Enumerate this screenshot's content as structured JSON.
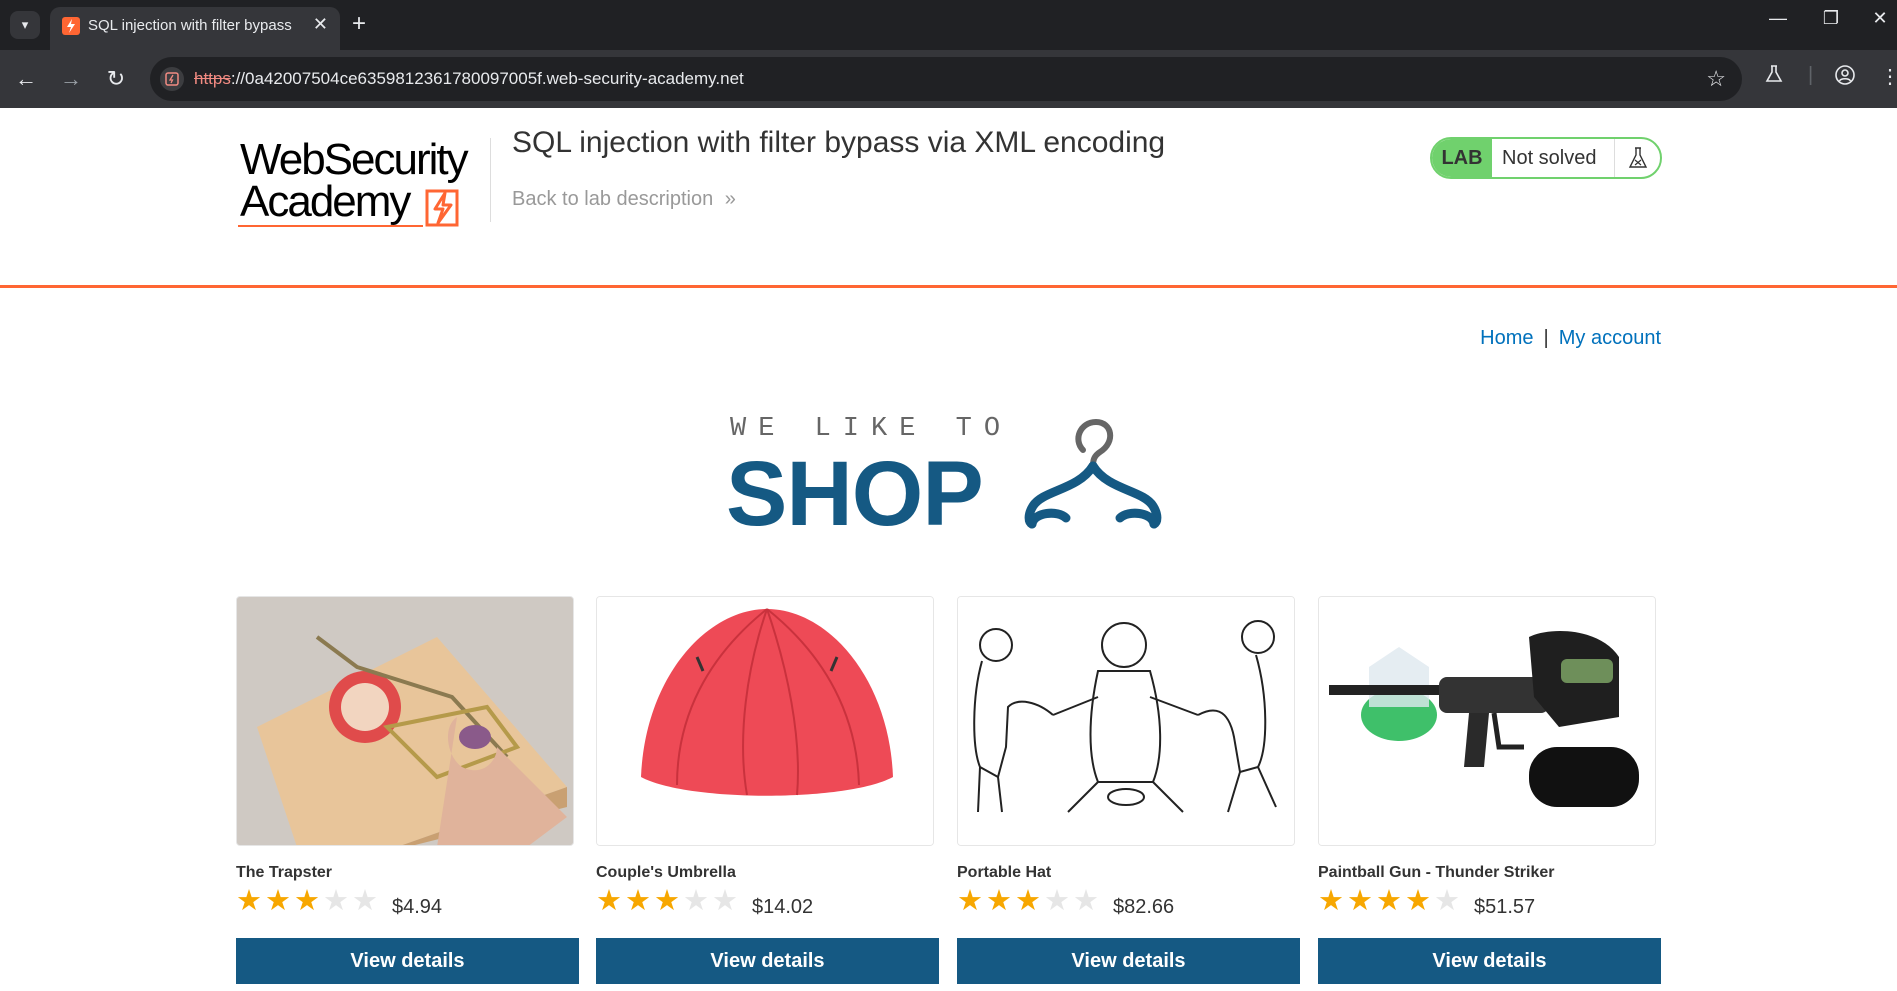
{
  "browser": {
    "tab_title": "SQL injection with filter bypass",
    "url_scheme": "https",
    "url_rest": "://0a42007504ce6359812361780097005f.web-security-academy.net"
  },
  "header": {
    "logo_line1": "WebSecurity",
    "logo_line2": "Academy",
    "lab_title": "SQL injection with filter bypass via XML encoding",
    "back_link": "Back to lab description",
    "lab_badge": "LAB",
    "lab_status": "Not solved",
    "colors": {
      "accent": "#ff6633",
      "status_green": "#70d16d",
      "primary": "#155983",
      "link": "#0071bc"
    }
  },
  "nav": {
    "home": "Home",
    "separator": "|",
    "account": "My account"
  },
  "hero": {
    "small": "WE LIKE TO",
    "big": "SHOP"
  },
  "products": [
    {
      "name": "The Trapster",
      "price": "$4.94",
      "rating": 3,
      "button": "View details",
      "image": "mousetrap-image"
    },
    {
      "name": "Couple's Umbrella",
      "price": "$14.02",
      "rating": 3,
      "button": "View details",
      "image": "umbrella-image"
    },
    {
      "name": "Portable Hat",
      "price": "$82.66",
      "rating": 3,
      "button": "View details",
      "image": "cartoon-image"
    },
    {
      "name": "Paintball Gun - Thunder Striker",
      "price": "$51.57",
      "rating": 4,
      "button": "View details",
      "image": "paintball-gun-image"
    }
  ]
}
